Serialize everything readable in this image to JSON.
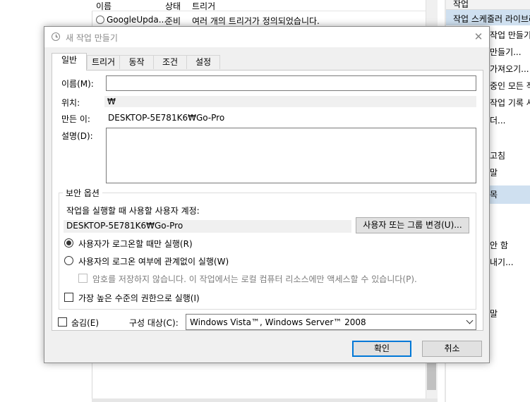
{
  "background": {
    "columns": [
      "이름",
      "상태",
      "트리거"
    ],
    "row": {
      "name": "GoogleUpda...",
      "status": "준비",
      "trigger": "여러 개의 트리거가 정의되었습니다."
    },
    "actions_header": "작업",
    "actions_selected": "작업 스케줄러 라이브러",
    "actions_items": [
      "작업 만들기",
      "만들기...",
      "가져오기...",
      "중인 모든 작",
      "작업 기록 사",
      "더...",
      "고침",
      "말",
      "목",
      "안 함",
      "내기...",
      "말"
    ]
  },
  "dialog": {
    "title": "새 작업 만들기",
    "close_glyph": "✕",
    "tabs": [
      "일반",
      "트리거",
      "동작",
      "조건",
      "설정"
    ],
    "general": {
      "name_label": "이름(M):",
      "name_value": "",
      "location_label": "위치:",
      "location_value": "₩",
      "author_label": "만든 이:",
      "author_value": "DESKTOP-5E781K6₩Go-Pro",
      "description_label": "설명(D):",
      "description_value": ""
    },
    "security": {
      "group_title": "보안 옵션",
      "account_prompt": "작업을 실행할 때 사용할 사용자 계정:",
      "account_value": "DESKTOP-5E781K6₩Go-Pro",
      "change_button": "사용자 또는 그룹 변경(U)...",
      "radio_logged_on": "사용자가 로그온할 때만 실행(R)",
      "radio_logged_on_checked": true,
      "radio_whether": "사용자의 로그온 여부에 관계없이 실행(W)",
      "no_store_password": "암호를 저장하지 않습니다. 이 작업에서는 로컬 컴퓨터 리소스에만 액세스할 수 있습니다(P).",
      "highest_privileges": "가장 높은 수준의 권한으로 실행(I)"
    },
    "hidden_label": "숨김(E)",
    "configure_label": "구성 대상(C):",
    "configure_value": "Windows Vista™, Windows Server™ 2008",
    "ok_button": "확인",
    "cancel_button": "취소"
  }
}
